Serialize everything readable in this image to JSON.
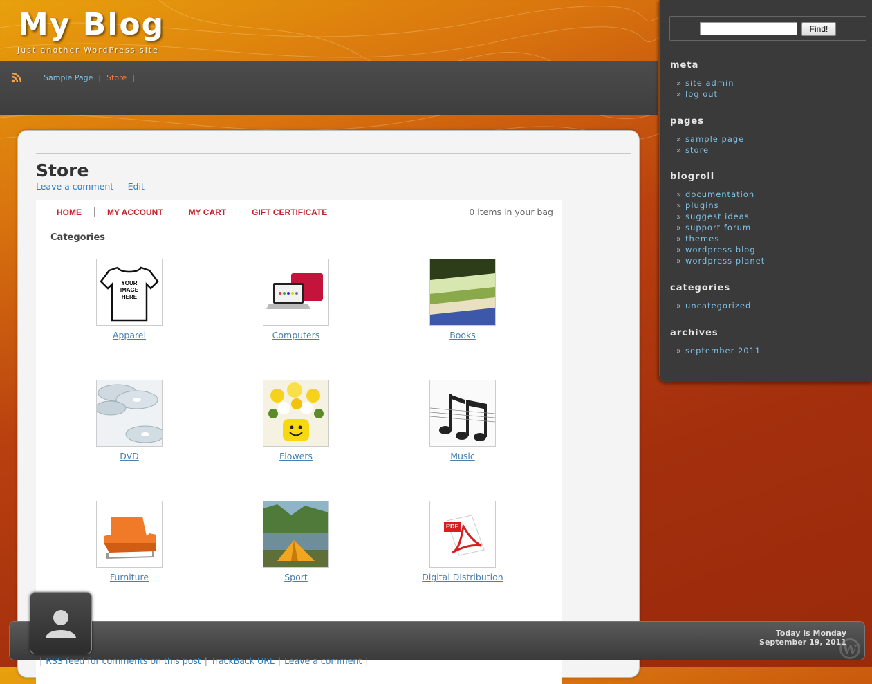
{
  "header": {
    "title": "My Blog",
    "tagline": "Just another WordPress site"
  },
  "nav": {
    "items": [
      {
        "label": "Sample Page"
      },
      {
        "label": "Store"
      }
    ],
    "separator": "|"
  },
  "page": {
    "title": "Store",
    "comment_link": "Leave a comment",
    "dash": "—",
    "edit_link": "Edit"
  },
  "store": {
    "menu": [
      "HOME",
      "MY ACCOUNT",
      "MY CART",
      "GIFT CERTIFICATE"
    ],
    "bag_status": "0 items in your bag",
    "categories_heading": "Categories",
    "categories": [
      {
        "label": "Apparel",
        "icon": "tshirt-image",
        "thumb_text": "YOUR IMAGE HERE"
      },
      {
        "label": "Computers",
        "icon": "laptop-image"
      },
      {
        "label": "Books",
        "icon": "books-image"
      },
      {
        "label": "DVD",
        "icon": "dvd-image"
      },
      {
        "label": "Flowers",
        "icon": "flowers-image"
      },
      {
        "label": "Music",
        "icon": "music-notes-image"
      },
      {
        "label": "Furniture",
        "icon": "sofa-image"
      },
      {
        "label": "Sport",
        "icon": "tent-image"
      },
      {
        "label": "Digital Distribution",
        "icon": "pdf-image",
        "thumb_text": "PDF"
      }
    ]
  },
  "footer": {
    "date_line1": "Today is Monday",
    "date_line2": "September 19, 2011",
    "links": [
      "RSS feed for comments on this post",
      "TrackBack URL",
      "Leave a comment"
    ]
  },
  "sidebar": {
    "search_button": "Find!",
    "search_value": "",
    "sections": [
      {
        "heading": "meta",
        "items": [
          "site admin",
          "log out"
        ]
      },
      {
        "heading": "pages",
        "items": [
          "sample page",
          "store"
        ]
      },
      {
        "heading": "blogroll",
        "items": [
          "documentation",
          "plugins",
          "suggest ideas",
          "support forum",
          "themes",
          "wordpress blog",
          "wordpress planet"
        ]
      },
      {
        "heading": "categories",
        "items": [
          "uncategorized"
        ]
      },
      {
        "heading": "archives",
        "items": [
          "september 2011"
        ]
      }
    ],
    "bullet": "»"
  },
  "colors": {
    "link": "#2a7fc0",
    "sidebar_link": "#7ec0e6",
    "store_menu": "#c8232c",
    "active_nav": "#ff7a3a"
  }
}
